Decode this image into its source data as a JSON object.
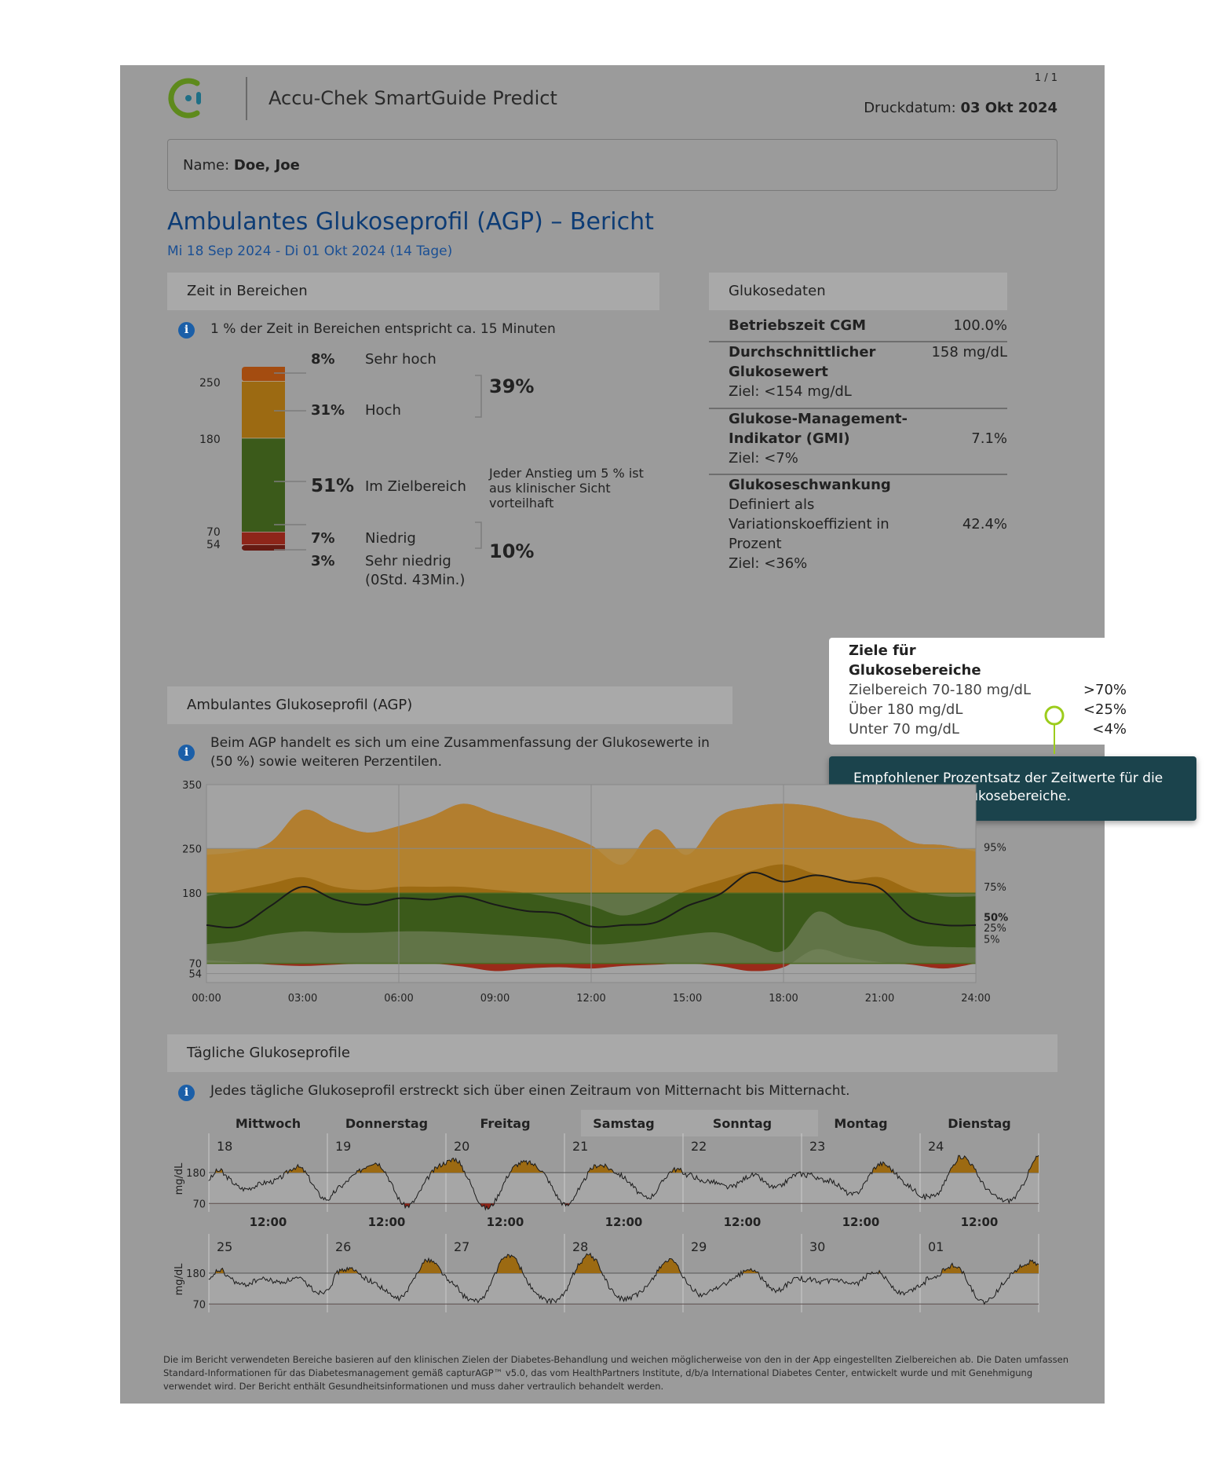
{
  "app": {
    "title": "Accu-Chek SmartGuide Predict",
    "page": "1 / 1",
    "print_label": "Druckdatum:",
    "print_date": "03 Okt 2024",
    "name_label": "Name:",
    "name_value": "Doe, Joe"
  },
  "report": {
    "title": "Ambulantes Glukoseprofil (AGP) – Bericht",
    "date_range": "Mi 18 Sep 2024 - Di 01 Okt 2024 (14 Tage)"
  },
  "tir": {
    "header": "Zeit in Bereichen",
    "info": "1 % der Zeit in Bereichen entspricht ca. 15 Minuten",
    "ticks": {
      "t250": "250",
      "t180": "180",
      "t70": "70",
      "t54": "54"
    },
    "rows": [
      {
        "pct": "8%",
        "label": "Sehr hoch"
      },
      {
        "pct": "31%",
        "label": "Hoch"
      },
      {
        "pct": "51%",
        "label": "Im Zielbereich"
      },
      {
        "pct": "7%",
        "label": "Niedrig"
      },
      {
        "pct": "3%",
        "label": "Sehr niedrig",
        "sub": "(0Std. 43Min.)"
      }
    ],
    "above_total": "39%",
    "below_total": "10%",
    "note": [
      "Jeder Anstieg um 5 % ist",
      "aus klinischer Sicht",
      "vorteilhaft"
    ],
    "values": {
      "very_high": 8,
      "high": 31,
      "target": 51,
      "low": 7,
      "very_low": 3
    },
    "colors": {
      "very_high": "#a44c10",
      "high": "#9c6a12",
      "target": "#3b5a1a",
      "low": "#8e2519",
      "very_low": "#661a12"
    }
  },
  "glucose": {
    "header": "Glukosedaten",
    "cgm_label": "Betriebszeit CGM",
    "cgm_value": "100.0%",
    "avg_label1": "Durchschnittlicher",
    "avg_label2": "Glukosewert",
    "avg_value": "158 mg/dL",
    "avg_target": "Ziel: <154 mg/dL",
    "gmi_label1": "Glukose-Management-",
    "gmi_label2": "Indikator (GMI)",
    "gmi_value": "7.1%",
    "gmi_target": "Ziel: <7%",
    "var_label": "Glukoseschwankung",
    "var_desc1": "Definiert als",
    "var_desc2": "Variationskoeffizient in",
    "var_desc3": "Prozent",
    "var_value": "42.4%",
    "var_target": "Ziel: <36%"
  },
  "targets": {
    "title1": "Ziele für",
    "title2": "Glukosebereiche",
    "rows": [
      {
        "label": "Zielbereich 70-180 mg/dL",
        "value": ">70%"
      },
      {
        "label": "Über 180 mg/dL",
        "value": "<25%"
      },
      {
        "label": "Unter 70 mg/dL",
        "value": "<4%"
      }
    ]
  },
  "tooltip": {
    "text": "Empfohlener Prozentsatz der Zeitwerte für die verschiedenen Glukosebereiche."
  },
  "agp": {
    "header": "Ambulantes Glukoseprofil (AGP)",
    "info1": "Beim AGP handelt es sich um eine Zusammenfassung der Glukosewerte in",
    "info2": "(50 %) sowie weiteren Perzentilen.",
    "y_ticks": [
      "350",
      "250",
      "180",
      "70",
      "54"
    ],
    "x_ticks": [
      "00:00",
      "03:00",
      "06:00",
      "09:00",
      "12:00",
      "15:00",
      "18:00",
      "21:00",
      "24:00"
    ],
    "pct_labels": {
      "p95": "95%",
      "p75": "75%",
      "p50": "50%",
      "p25": "25%",
      "p5": "5%"
    },
    "colors": {
      "target": "#3b5a1a",
      "band_high": "#9c6a12",
      "outer_top": "#a05e3b",
      "low": "#8e2519",
      "median": "#1a1a1a"
    }
  },
  "chart_data": {
    "type": "area",
    "x": [
      0,
      1,
      2,
      3,
      4,
      5,
      6,
      7,
      8,
      9,
      10,
      11,
      12,
      13,
      14,
      15,
      16,
      17,
      18,
      19,
      20,
      21,
      22,
      23,
      24
    ],
    "series": [
      {
        "name": "95%",
        "values": [
          240,
          245,
          260,
          310,
          290,
          275,
          285,
          300,
          320,
          305,
          290,
          275,
          255,
          225,
          280,
          240,
          300,
          315,
          320,
          315,
          300,
          290,
          260,
          255,
          245
        ]
      },
      {
        "name": "75%",
        "values": [
          175,
          185,
          195,
          205,
          190,
          185,
          190,
          190,
          190,
          185,
          180,
          170,
          160,
          145,
          160,
          185,
          200,
          215,
          225,
          210,
          200,
          205,
          185,
          175,
          175
        ]
      },
      {
        "name": "50%",
        "values": [
          130,
          128,
          160,
          190,
          170,
          162,
          172,
          170,
          175,
          162,
          152,
          148,
          128,
          130,
          134,
          160,
          178,
          212,
          198,
          208,
          198,
          188,
          142,
          130,
          130
        ]
      },
      {
        "name": "25%",
        "values": [
          100,
          105,
          115,
          120,
          118,
          118,
          120,
          120,
          118,
          115,
          112,
          108,
          100,
          102,
          108,
          115,
          118,
          102,
          90,
          150,
          130,
          120,
          100,
          96,
          95
        ]
      },
      {
        "name": "5%",
        "values": [
          75,
          72,
          68,
          66,
          68,
          70,
          70,
          70,
          65,
          58,
          62,
          64,
          62,
          66,
          68,
          70,
          66,
          58,
          64,
          92,
          80,
          72,
          68,
          62,
          70
        ]
      }
    ],
    "xlabel": "",
    "ylabel": "",
    "ylim": [
      40,
      350
    ],
    "x_tick_labels": [
      "00:00",
      "03:00",
      "06:00",
      "09:00",
      "12:00",
      "15:00",
      "18:00",
      "21:00",
      "24:00"
    ],
    "y_tick_labels": [
      "54",
      "70",
      "180",
      "250",
      "350"
    ],
    "target_range": [
      70,
      180
    ]
  },
  "daily": {
    "header": "Tägliche Glukoseprofile",
    "info": "Jedes tägliche Glukoseprofil erstreckt sich über einen Zeitraum von Mitternacht bis Mitternacht.",
    "weekdays": [
      "Mittwoch",
      "Donnerstag",
      "Freitag",
      "Samstag",
      "Sonntag",
      "Montag",
      "Dienstag"
    ],
    "week1": [
      "18",
      "19",
      "20",
      "21",
      "22",
      "23",
      "24"
    ],
    "week2": [
      "25",
      "26",
      "27",
      "28",
      "29",
      "30",
      "01"
    ],
    "noon": "12:00",
    "y180": "180",
    "y70": "70",
    "unit": "mg/dL",
    "colors": {
      "above": "#9c6a12",
      "below": "#8e2519",
      "line": "#1a1a1a"
    }
  },
  "footer": {
    "l1": "Die im Bericht verwendeten Bereiche basieren auf den klinischen Zielen der Diabetes-Behandlung und weichen möglicherweise von den in der App eingestellten Zielbereichen ab. Die Daten umfassen",
    "l2": "Standard-Informationen für das Diabetesmanagement gemäß capturAGP™ v5.0, das vom HealthPartners Institute, d/b/a International Diabetes Center, entwickelt wurde und mit Genehmigung",
    "l3": "verwendet wird. Der Bericht enthält Gesundheitsinformationen und muss daher vertraulich behandelt werden."
  }
}
